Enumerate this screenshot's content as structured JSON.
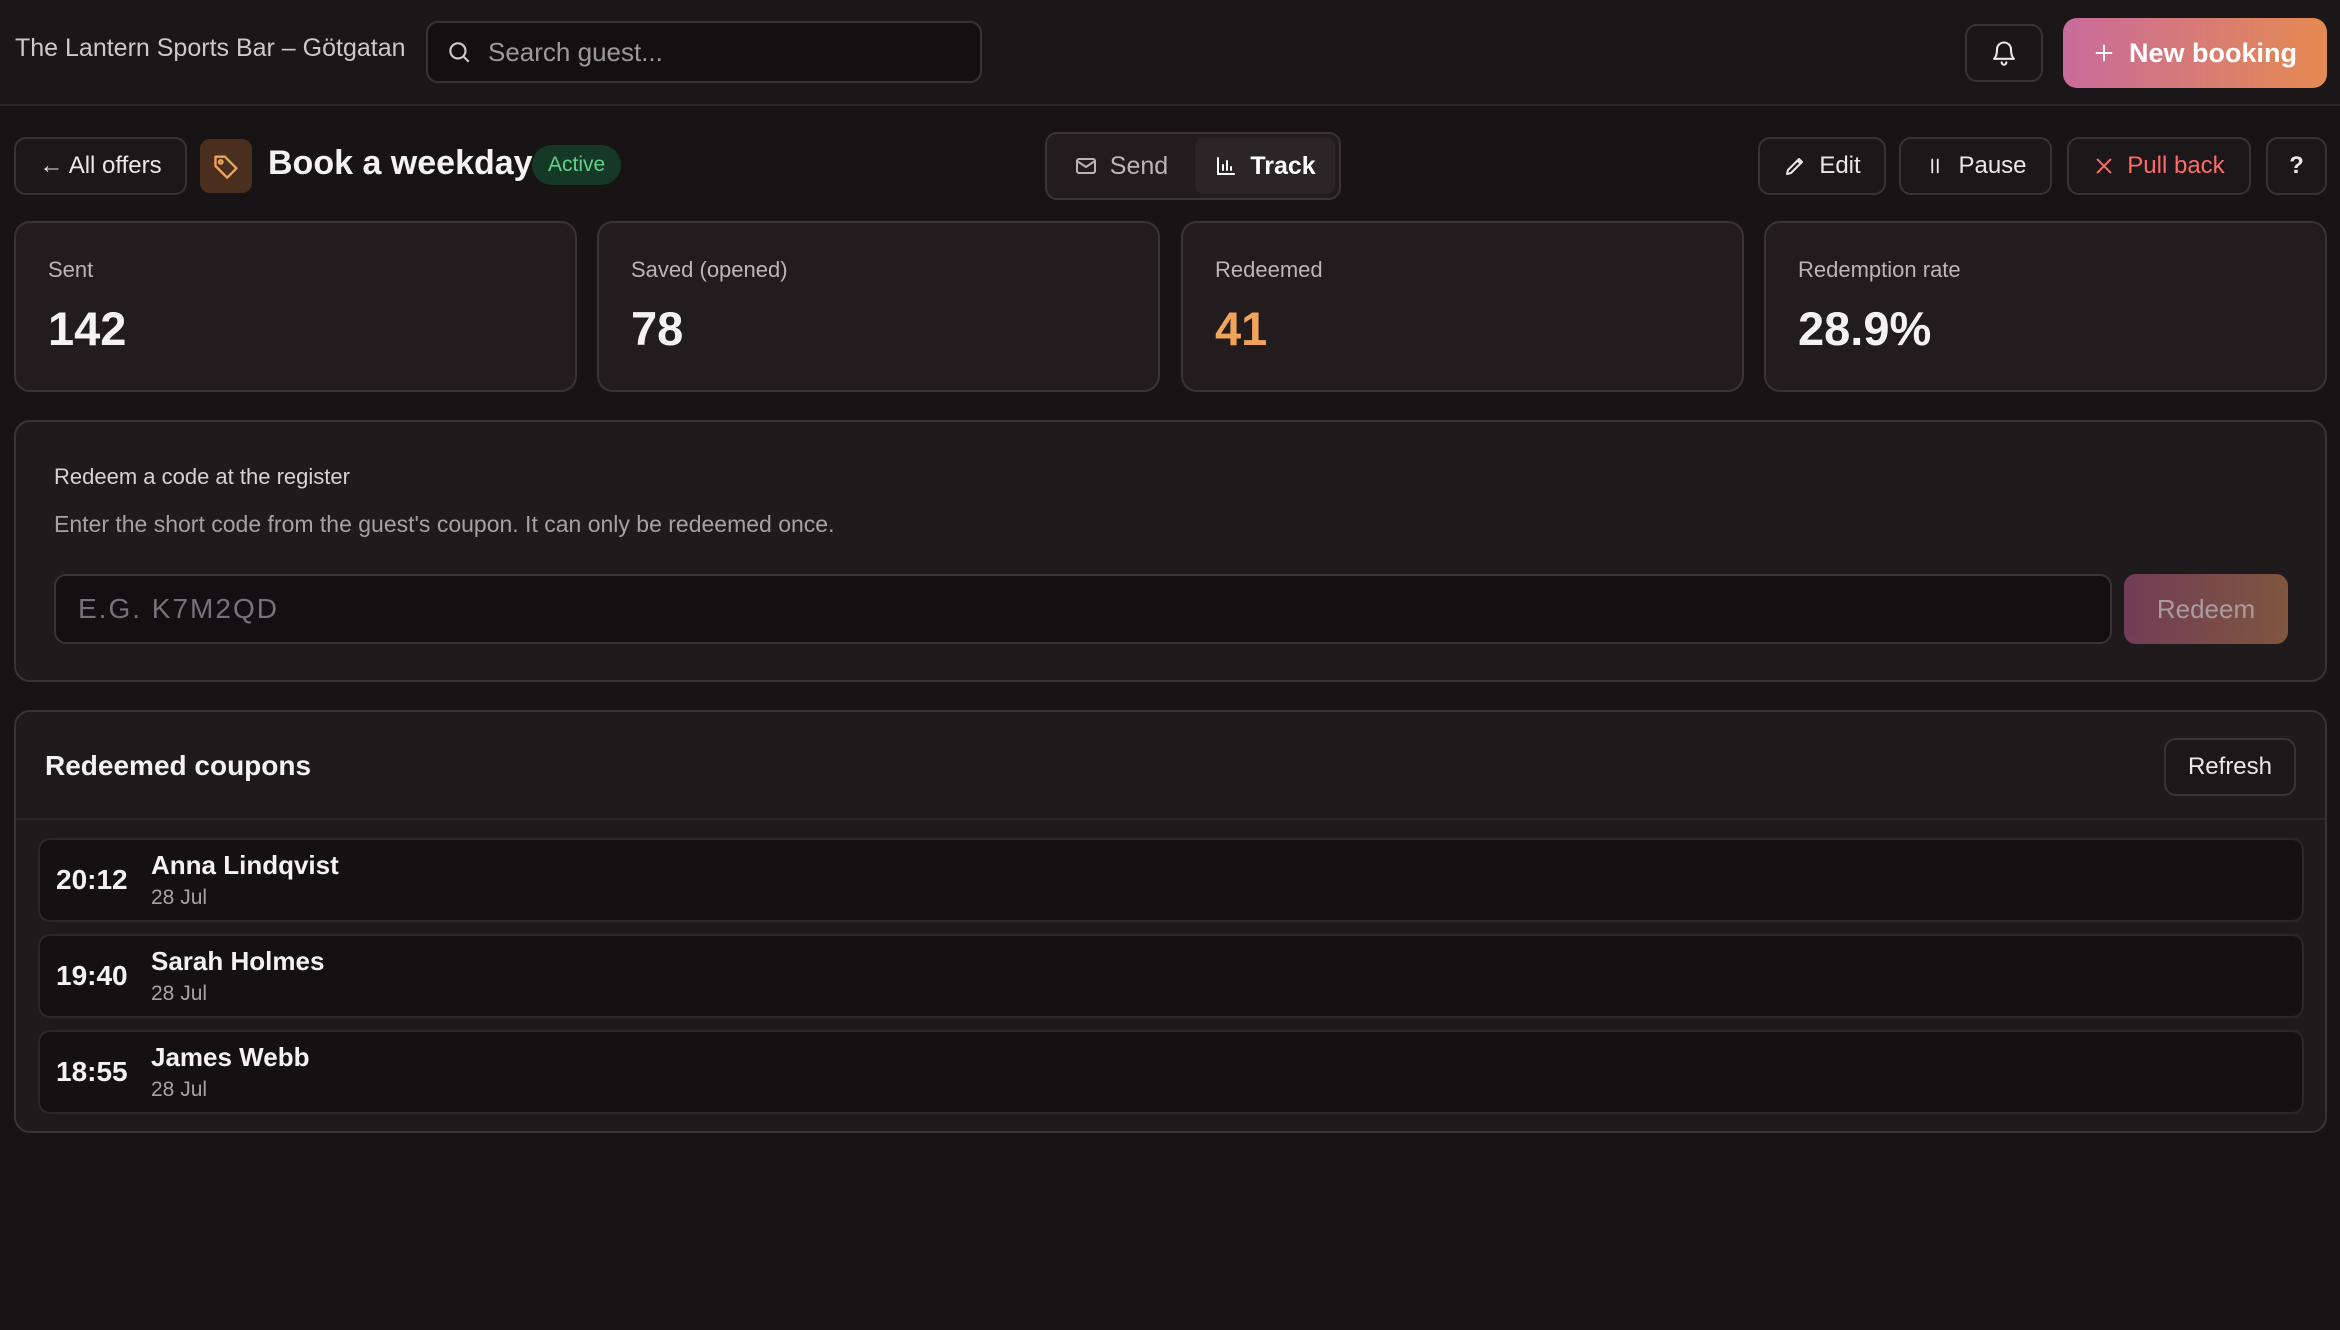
{
  "header": {
    "venue": "The Lantern Sports Bar – Götgatan",
    "search_placeholder": "Search guest...",
    "new_booking_label": "New booking"
  },
  "offer": {
    "back_label": "← All offers",
    "title": "Book a weekday",
    "status": "Active",
    "tabs": [
      {
        "label": "Send",
        "active": false
      },
      {
        "label": "Track",
        "active": true
      }
    ],
    "actions": {
      "edit": "Edit",
      "pause": "Pause",
      "pull_back": "Pull back",
      "help": "?"
    }
  },
  "stats": [
    {
      "label": "Sent",
      "value": "142"
    },
    {
      "label": "Saved (opened)",
      "value": "78"
    },
    {
      "label": "Redeemed",
      "value": "41"
    },
    {
      "label": "Redemption rate",
      "value": "28.9%"
    }
  ],
  "redeem": {
    "heading": "Redeem a code at the register",
    "description": "Enter the short code from the guest's coupon. It can only be redeemed once.",
    "placeholder": "E.G. K7M2QD",
    "button_label": "Redeem"
  },
  "redeemed_list": {
    "title": "Redeemed coupons",
    "refresh_label": "Refresh",
    "items": [
      {
        "time": "20:12",
        "name": "Anna Lindqvist",
        "date": "28 Jul"
      },
      {
        "time": "19:40",
        "name": "Sarah Holmes",
        "date": "28 Jul"
      },
      {
        "time": "18:55",
        "name": "James Webb",
        "date": "28 Jul"
      }
    ]
  },
  "colors": {
    "accent_orange": "#f0a35a",
    "active_green": "#5fd18c",
    "danger_red": "#ff6a6a",
    "gradient_start": "#c96b9c",
    "gradient_end": "#e58a51"
  }
}
